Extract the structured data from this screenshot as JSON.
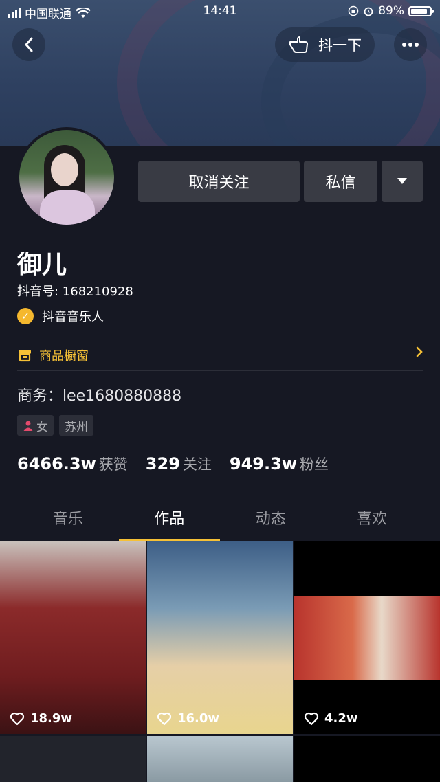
{
  "status_bar": {
    "carrier": "中国联通",
    "time": "14:41",
    "battery": "89%",
    "battery_level": 0.89
  },
  "header": {
    "shake_label": "抖一下"
  },
  "profile": {
    "unfollow_label": "取消关注",
    "message_label": "私信",
    "name": "御儿",
    "douyin_id": "抖音号: 168210928",
    "verify_label": "抖音音乐人",
    "shop_label": "商品橱窗",
    "business": "商务：lee1680880888",
    "tags": [
      "女",
      "苏州"
    ],
    "stats": [
      {
        "num": "6466.3w",
        "label": "获赞"
      },
      {
        "num": "329",
        "label": "关注"
      },
      {
        "num": "949.3w",
        "label": "粉丝"
      }
    ]
  },
  "tabs": [
    {
      "label": "音乐",
      "active": false
    },
    {
      "label": "作品",
      "active": true
    },
    {
      "label": "动态",
      "active": false
    },
    {
      "label": "喜欢",
      "active": false
    }
  ],
  "videos": [
    {
      "likes": "18.9w"
    },
    {
      "likes": "16.0w"
    },
    {
      "likes": "4.2w"
    }
  ],
  "colors": {
    "background": "#161823",
    "accent": "#f5c036",
    "button": "#393b44"
  }
}
